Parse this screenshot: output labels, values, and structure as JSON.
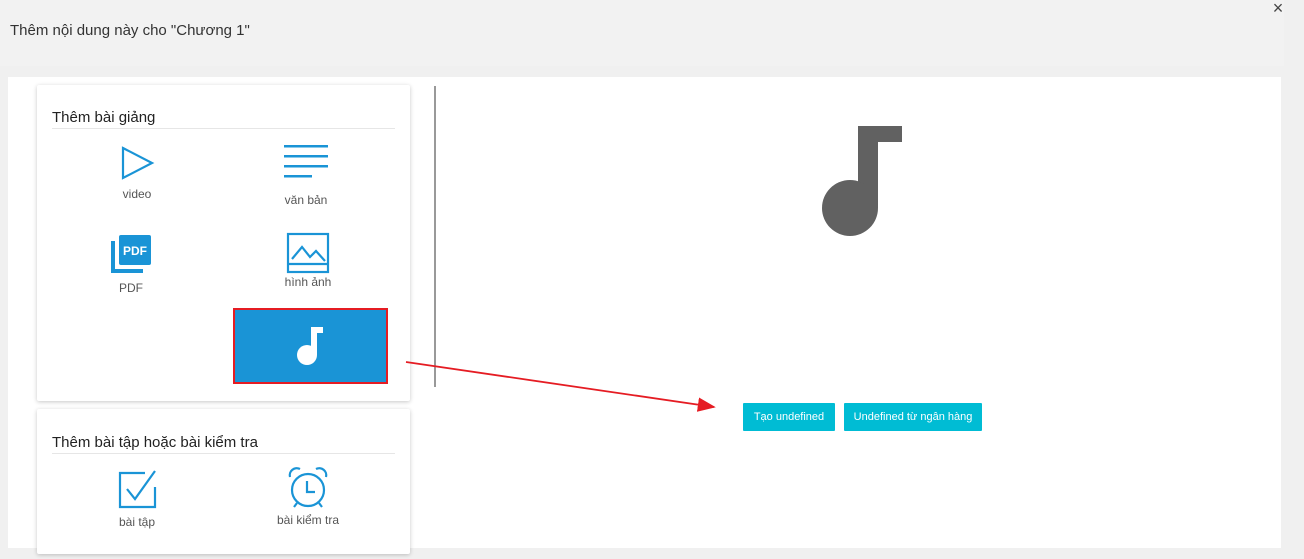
{
  "dialog": {
    "title": "Thêm nội dung này cho \"Chương 1\"",
    "close_symbol": "×"
  },
  "lectures": {
    "title": "Thêm bài giảng",
    "items": [
      {
        "label": "video",
        "icon": "play-icon"
      },
      {
        "label": "văn bản",
        "icon": "text-lines-icon"
      },
      {
        "label": "PDF",
        "icon": "pdf-icon",
        "icon_text": "PDF"
      },
      {
        "label": "hình ảnh",
        "icon": "image-icon"
      },
      {
        "label": "",
        "icon": "music-note-icon",
        "selected": true
      }
    ]
  },
  "exercises": {
    "title": "Thêm bài tập hoặc bài kiểm tra",
    "items": [
      {
        "label": "bài tập",
        "icon": "checkbox-icon"
      },
      {
        "label": "bài kiểm tra",
        "icon": "alarm-clock-icon"
      }
    ]
  },
  "preview": {
    "icon": "music-note-icon",
    "buttons": {
      "create": "Tạo undefined",
      "from_bank": "Undefined từ ngân hàng"
    }
  },
  "colors": {
    "accent_blue": "#1a94d6",
    "button_cyan": "#00bcd4",
    "highlight_red": "#e51c23",
    "icon_gray": "#616161"
  }
}
